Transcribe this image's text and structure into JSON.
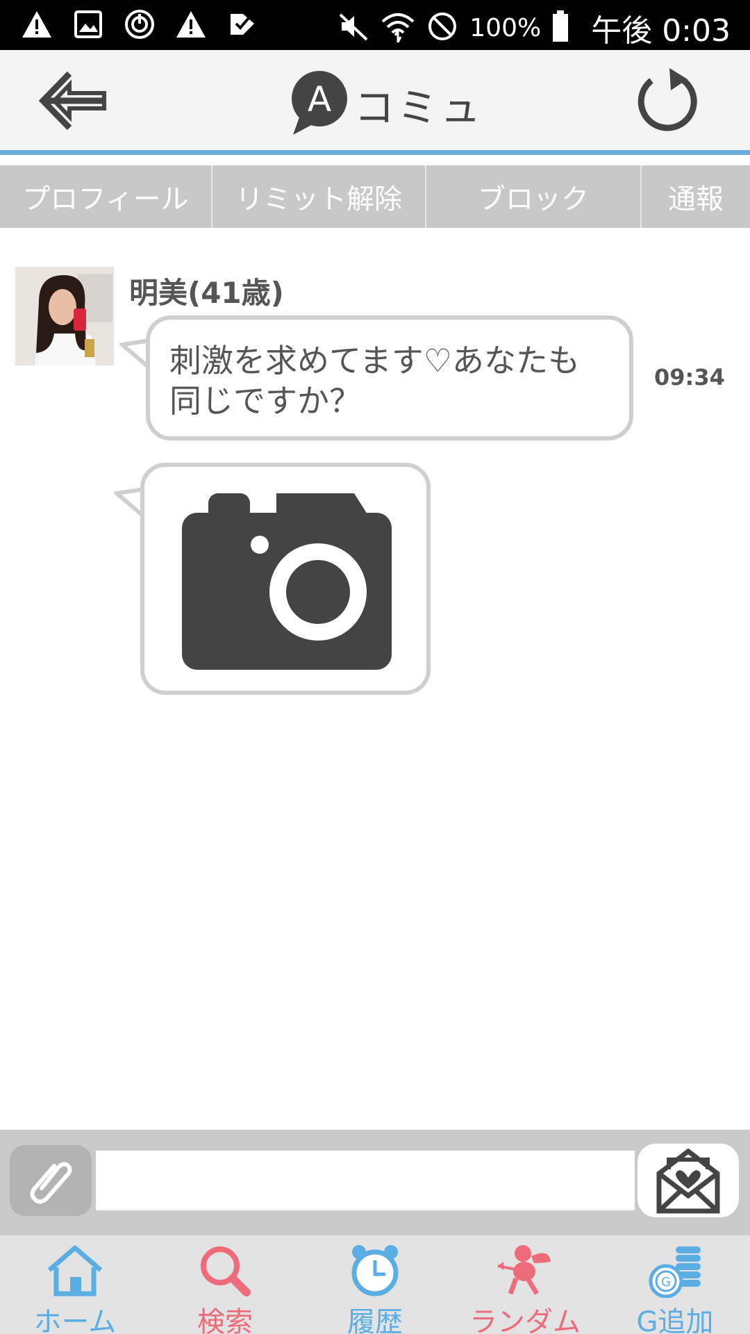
{
  "status_bar": {
    "battery_percent": "100%",
    "time": "午後 0:03"
  },
  "header": {
    "logo_letter": "A",
    "title": "コミュ"
  },
  "tabs": [
    {
      "label": "プロフィール"
    },
    {
      "label": "リミット解除"
    },
    {
      "label": "ブロック"
    },
    {
      "label": "通報"
    }
  ],
  "conversation": {
    "sender_name": "明美(41歳)",
    "messages": [
      {
        "type": "text",
        "line1": "刺激を求めてます♡あなたも",
        "line2": "同じですか？",
        "time": "09:34"
      },
      {
        "type": "photo",
        "icon": "camera-icon"
      }
    ]
  },
  "composer": {
    "input_value": "",
    "attach_icon": "paperclip-icon",
    "send_icon": "envelope-heart-icon"
  },
  "bottom_nav": [
    {
      "label": "ホーム",
      "icon": "home-icon",
      "color": "#5aaee4"
    },
    {
      "label": "検索",
      "icon": "search-icon",
      "color": "#ee6b7b"
    },
    {
      "label": "履歴",
      "icon": "clock-icon",
      "color": "#5aaee4"
    },
    {
      "label": "ランダム",
      "icon": "cupid-icon",
      "color": "#ee6b7b"
    },
    {
      "label": "G追加",
      "icon": "coins-icon",
      "color": "#5aaee4"
    }
  ],
  "colors": {
    "accent_blue": "#6aaee0",
    "tab_gray": "#c8c8c8",
    "bubble_border": "#cfcfcf"
  }
}
